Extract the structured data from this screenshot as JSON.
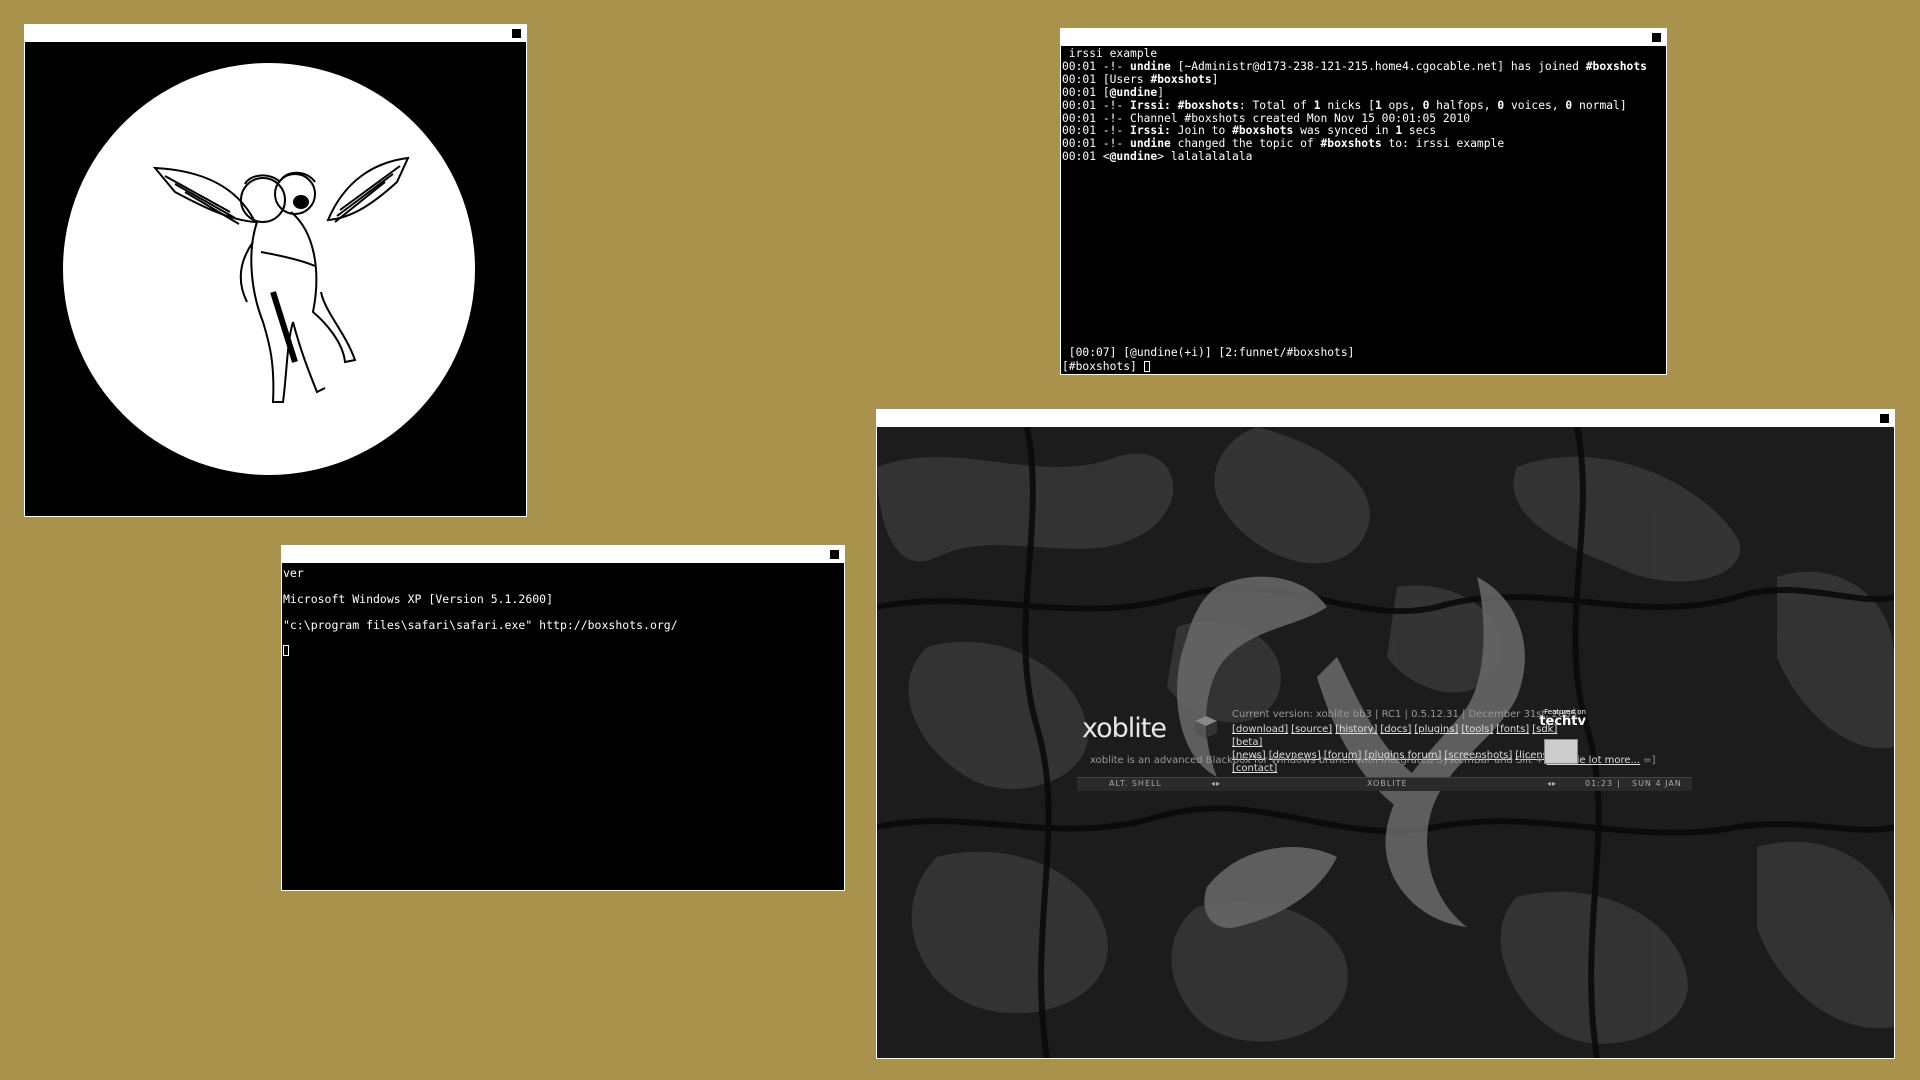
{
  "windows": {
    "image_viewer": {
      "close_label": ""
    },
    "irssi": {
      "title": " irssi example",
      "lines": [
        {
          "time": "00:01",
          "parts": [
            {
              "t": " -!- "
            },
            {
              "t": "undine",
              "b": true
            },
            {
              "t": " [~Administr@d173-238-121-215.home4.cgocable.net] has joined "
            },
            {
              "t": "#boxshots",
              "b": true
            }
          ]
        },
        {
          "time": "00:01",
          "parts": [
            {
              "t": " [Users "
            },
            {
              "t": "#boxshots",
              "b": true
            },
            {
              "t": "]"
            }
          ]
        },
        {
          "time": "00:01",
          "parts": [
            {
              "t": " ["
            },
            {
              "t": "@undine",
              "b": true
            },
            {
              "t": "]"
            }
          ]
        },
        {
          "time": "00:01",
          "parts": [
            {
              "t": " -!- "
            },
            {
              "t": "Irssi:",
              "b": true
            },
            {
              "t": " "
            },
            {
              "t": "#boxshots",
              "b": true
            },
            {
              "t": ": Total of "
            },
            {
              "t": "1",
              "b": true
            },
            {
              "t": " nicks ["
            },
            {
              "t": "1",
              "b": true
            },
            {
              "t": " ops, "
            },
            {
              "t": "0",
              "b": true
            },
            {
              "t": " halfops, "
            },
            {
              "t": "0",
              "b": true
            },
            {
              "t": " voices, "
            },
            {
              "t": "0",
              "b": true
            },
            {
              "t": " normal]"
            }
          ]
        },
        {
          "time": "00:01",
          "parts": [
            {
              "t": " -!- Channel #boxshots created Mon Nov 15 00:01:05 2010"
            }
          ]
        },
        {
          "time": "00:01",
          "parts": [
            {
              "t": " -!- "
            },
            {
              "t": "Irssi:",
              "b": true
            },
            {
              "t": " Join to "
            },
            {
              "t": "#boxshots",
              "b": true
            },
            {
              "t": " was synced in "
            },
            {
              "t": "1",
              "b": true
            },
            {
              "t": " secs"
            }
          ]
        },
        {
          "time": "00:01",
          "parts": [
            {
              "t": " -!- "
            },
            {
              "t": "undine",
              "b": true
            },
            {
              "t": " changed the topic of "
            },
            {
              "t": "#boxshots",
              "b": true
            },
            {
              "t": " to: irssi example"
            }
          ]
        },
        {
          "time": "00:01",
          "parts": [
            {
              "t": " <"
            },
            {
              "t": "@undine",
              "b": true
            },
            {
              "t": "> lalalalalala"
            }
          ]
        }
      ],
      "status_bar": " [00:07] [@undine(+i)] [2:funnet/#boxshots]",
      "prompt": "[#boxshots] "
    },
    "cmd": {
      "lines": [
        "ver",
        "",
        "Microsoft Windows XP [Version 5.1.2600]",
        "",
        "\"c:\\program files\\safari\\safari.exe\" http://boxshots.org/",
        ""
      ]
    },
    "xoblite": {
      "logo": "xoblite",
      "version": "Current version: xoblite bb3 | RC1 | 0.5.12.31 | December 31st, 2005",
      "links": [
        "[download]",
        "[source]",
        "[history]",
        "[docs]",
        "[plugins]",
        "[tools]",
        "[fonts]",
        "[sdk]",
        "[beta]",
        "[news]",
        "[devnews]",
        "[forum]",
        "[plugins forum]",
        "[screenshots]",
        "[license]",
        "[contact]"
      ],
      "description": "xoblite is an advanced Blackbox for Windows branch with integrated SystemBar and Slit + ",
      "more_link": "a whole lot more...",
      "description_end": " =]",
      "featured_small": "Featured on",
      "featured_brand": "techtv",
      "toolbar": {
        "left": "ALT. SHELL",
        "center": "XOBLITE",
        "time": "01:23",
        "date": "SUN 4 JAN"
      }
    }
  }
}
